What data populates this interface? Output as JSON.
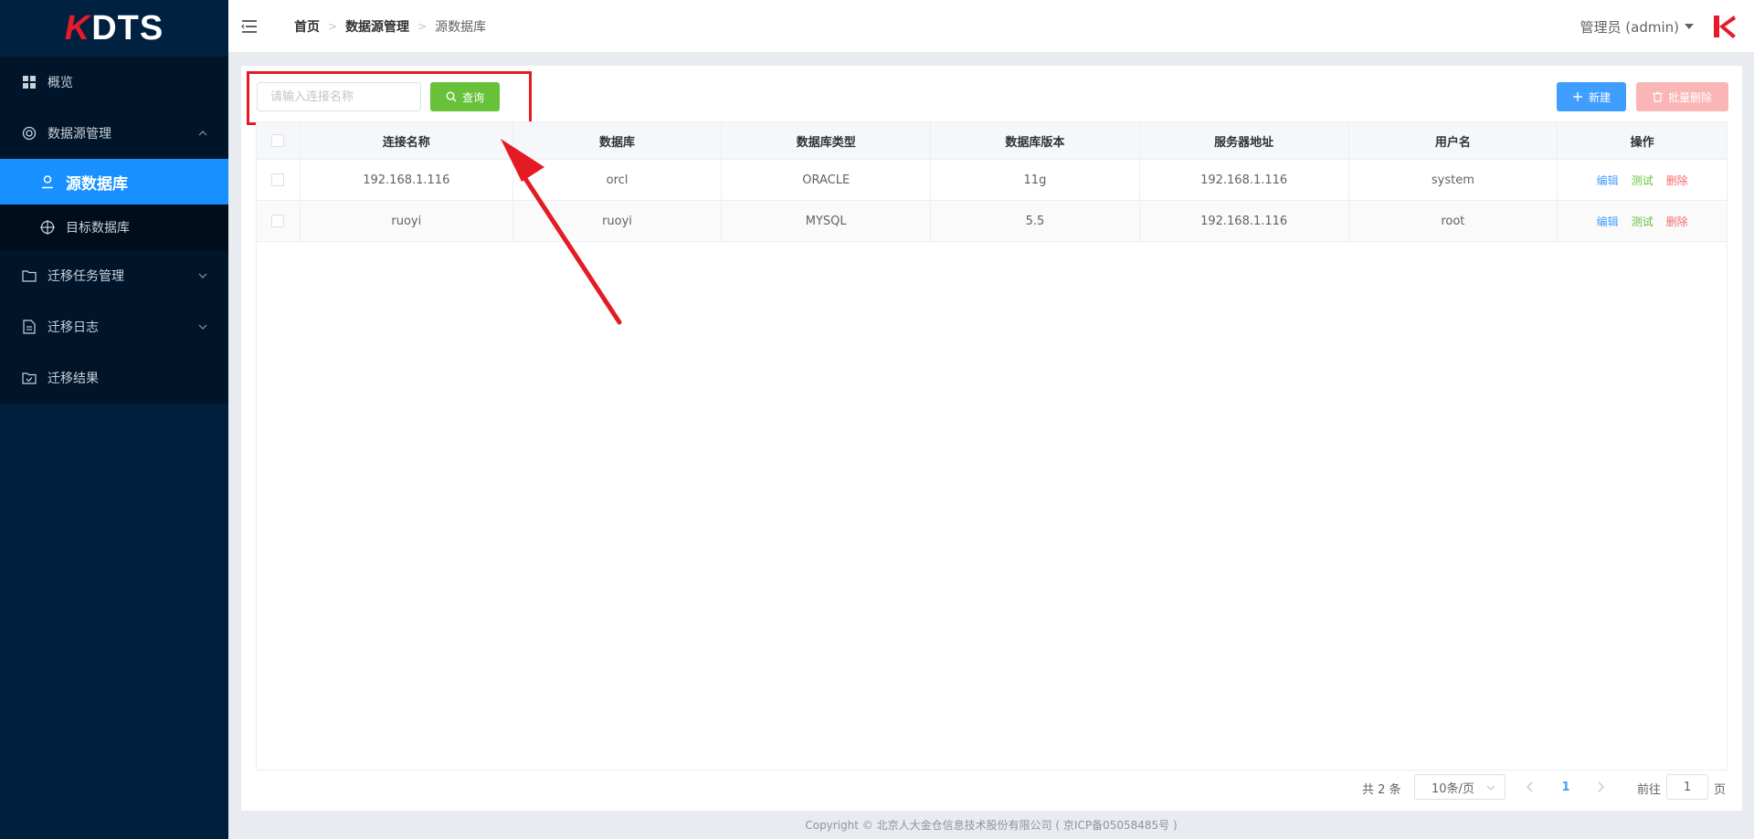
{
  "app": {
    "logo_prefix": "K",
    "logo_text": "DTS"
  },
  "sidebar": {
    "items": [
      {
        "label": "概览",
        "icon": "grid-icon"
      },
      {
        "label": "数据源管理",
        "icon": "database-ring-icon",
        "expanded": true,
        "children": [
          {
            "label": "源数据库",
            "icon": "user-icon",
            "active": true
          },
          {
            "label": "目标数据库",
            "icon": "target-icon"
          }
        ]
      },
      {
        "label": "迁移任务管理",
        "icon": "folder-icon"
      },
      {
        "label": "迁移日志",
        "icon": "document-icon"
      },
      {
        "label": "迁移结果",
        "icon": "folder-check-icon"
      }
    ]
  },
  "header": {
    "breadcrumb": [
      "首页",
      "数据源管理",
      "源数据库"
    ],
    "user": "管理员 (admin)"
  },
  "toolbar": {
    "search_placeholder": "请输入连接名称",
    "search_value": "",
    "query_label": "查询",
    "new_label": "新建",
    "batch_delete_label": "批量删除"
  },
  "table": {
    "columns": [
      "连接名称",
      "数据库",
      "数据库类型",
      "数据库版本",
      "服务器地址",
      "用户名",
      "操作"
    ],
    "rows": [
      [
        "192.168.1.116",
        "orcl",
        "ORACLE",
        "11g",
        "192.168.1.116",
        "system"
      ],
      [
        "ruoyi",
        "ruoyi",
        "MYSQL",
        "5.5",
        "192.168.1.116",
        "root"
      ]
    ],
    "actions": [
      "编辑",
      "测试",
      "删除"
    ]
  },
  "pagination": {
    "total_text": "共 2 条",
    "page_size": "10条/页",
    "current_page": "1",
    "goto_label": "前往",
    "goto_value": "1",
    "page_suffix": "页"
  },
  "footer": {
    "copyright": "Copyright © 北京人大金仓信息技术股份有限公司 ( 京ICP备05058485号 )"
  },
  "colors": {
    "sidebar_bg": "#001f3d",
    "active": "#1890ff",
    "query_button": "#67c23a",
    "new_button": "#409eff",
    "batch_delete_button": "#fab6b6",
    "annotation": "#e41b23"
  }
}
